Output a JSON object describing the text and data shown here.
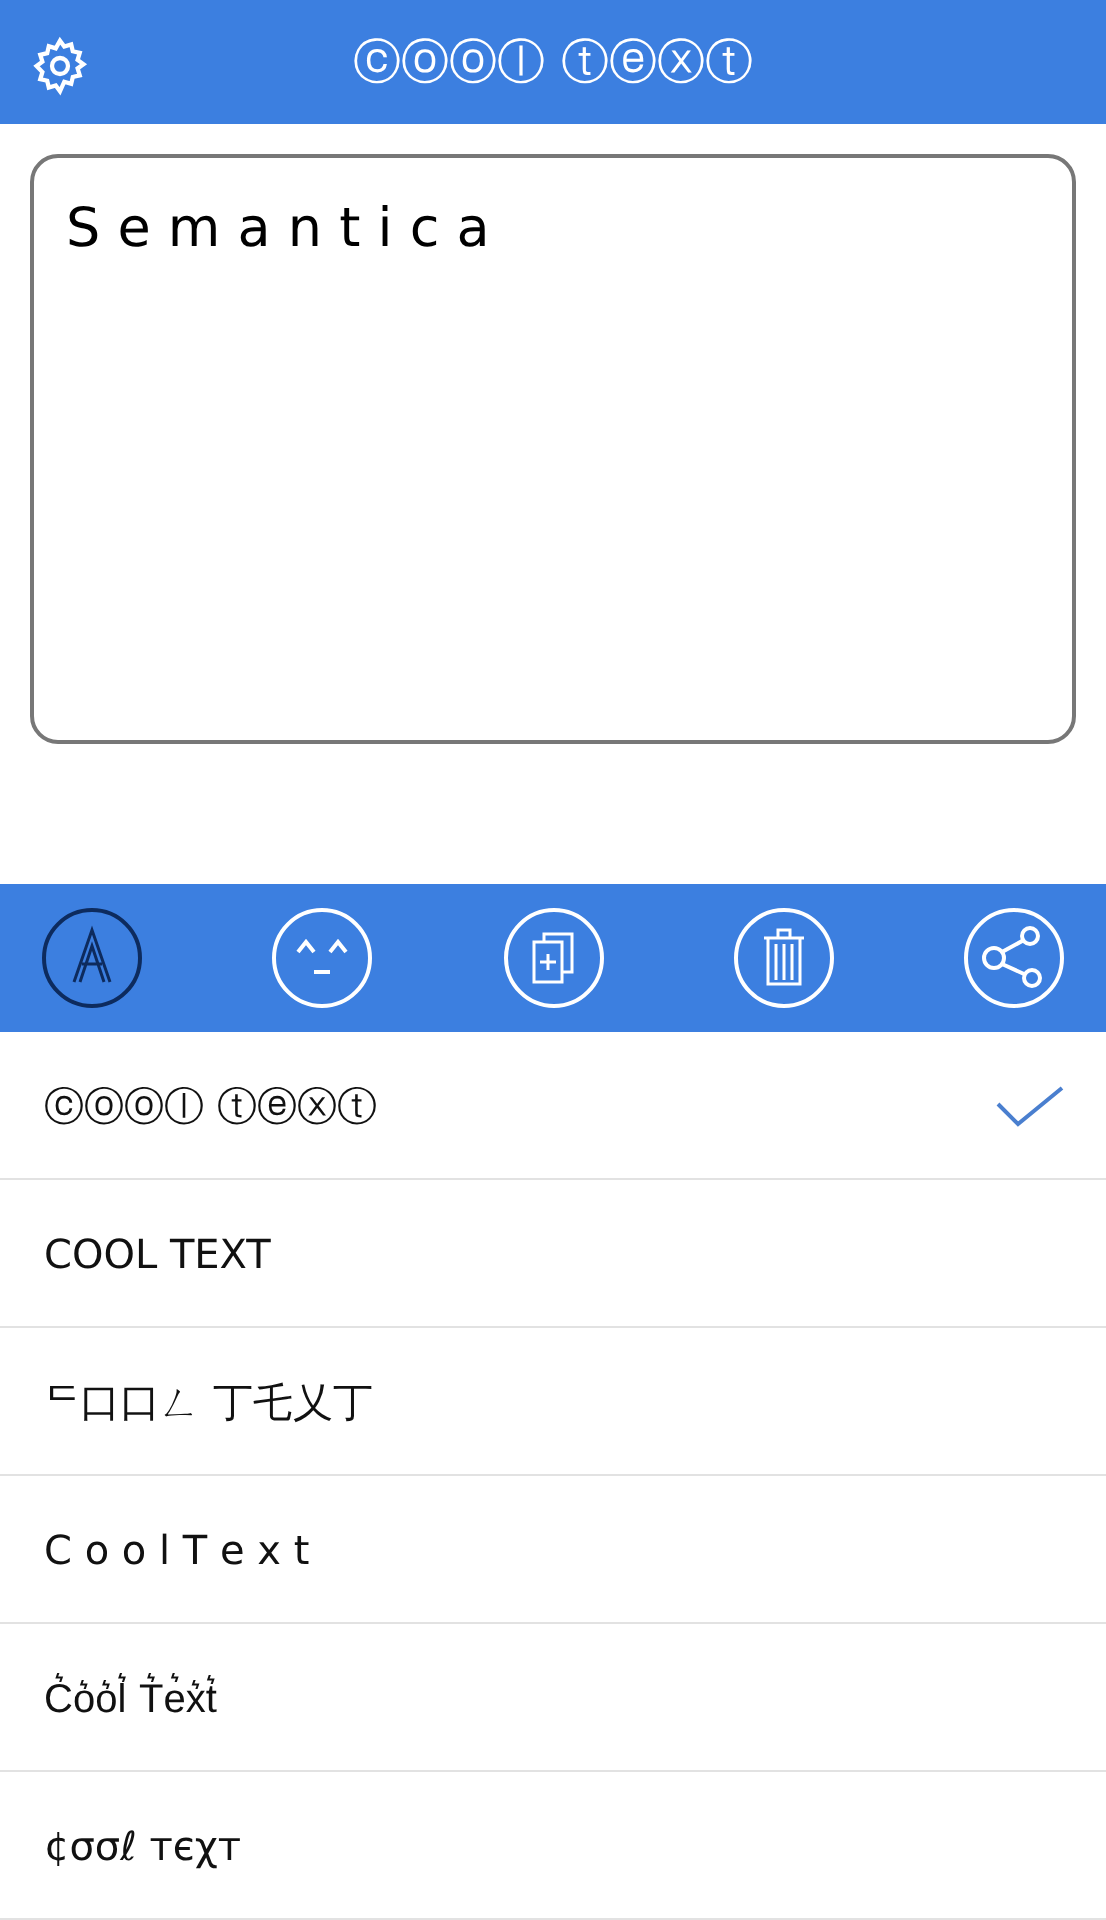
{
  "header": {
    "title": "ⓒⓞⓞⓛ ⓣⓔⓧⓣ"
  },
  "editor": {
    "value": "S e m a n t i c a"
  },
  "toolbar": [
    {
      "kind": "font",
      "selected": true
    },
    {
      "kind": "emoji",
      "selected": false
    },
    {
      "kind": "copy",
      "selected": false
    },
    {
      "kind": "trash",
      "selected": false
    },
    {
      "kind": "share",
      "selected": false
    }
  ],
  "styles": [
    {
      "label": "ⓒⓞⓞⓛ ⓣⓔⓧⓣ",
      "selected": true
    },
    {
      "label": "COOL TEXT",
      "selected": false
    },
    {
      "label": "ᄃ口口ㄥ 丁乇乂丁",
      "selected": false
    },
    {
      "label": "C o o l T e x t",
      "selected": false
    },
    {
      "label": "C͛o͛o͛l͛ T͛e͛x͛t͛",
      "selected": false
    },
    {
      "label": "¢σσℓ тєχт",
      "selected": false
    }
  ]
}
